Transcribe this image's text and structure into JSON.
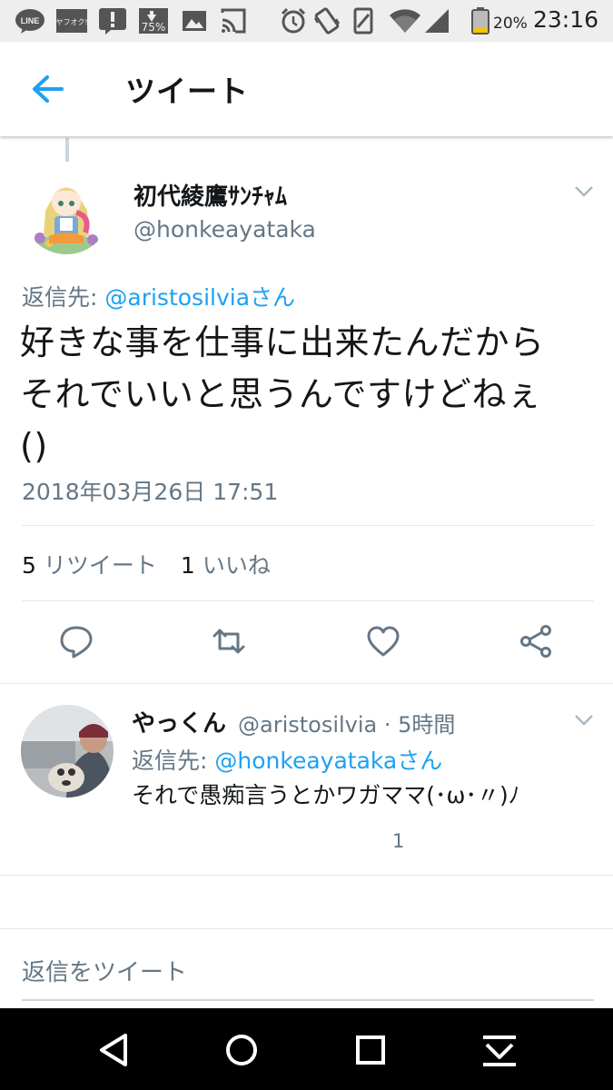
{
  "status_bar": {
    "time": "23:16",
    "battery_percent": "20%",
    "icons": [
      "line-icon",
      "yahuoku-icon",
      "alert-icon",
      "storage-icon",
      "image-icon",
      "cast-icon",
      "alarm-icon",
      "vibrate-icon",
      "rotate-icon",
      "wifi-icon",
      "signal-icon",
      "battery-icon"
    ],
    "storage_badge": "75%",
    "line_label": "LINE",
    "yahuoku_label": "ヤフオク!"
  },
  "app_bar": {
    "title": "ツイート"
  },
  "tweet": {
    "author_name": "初代綾鷹ｻﾝﾁｬﾑ",
    "author_handle": "@honkeayataka",
    "reply_to_prefix": "返信先: ",
    "reply_to_mention": "@aristosilviaさん",
    "text_lines": [
      "好きな事を仕事に出来たんだから",
      "それでいいと思うんですけどねぇ",
      "()"
    ],
    "timestamp": "2018年03月26日 17:51",
    "retweets_count": "5",
    "retweets_label": "リツイート",
    "likes_count": "1",
    "likes_label": "いいね"
  },
  "reply": {
    "author_name": "やっくん",
    "meta": "@aristosilvia · 5時間",
    "reply_to_prefix": "返信先: ",
    "reply_to_mention": "@honkeayatakaさん",
    "text": "それで愚痴言うとかワガママ(･ω･〃)ﾉ",
    "like_count": "1"
  },
  "compose": {
    "placeholder": "返信をツイート"
  },
  "colors": {
    "accent": "#1da1f2",
    "text_primary": "#14171a",
    "text_secondary": "#657786",
    "divider": "#e1e8ed"
  }
}
